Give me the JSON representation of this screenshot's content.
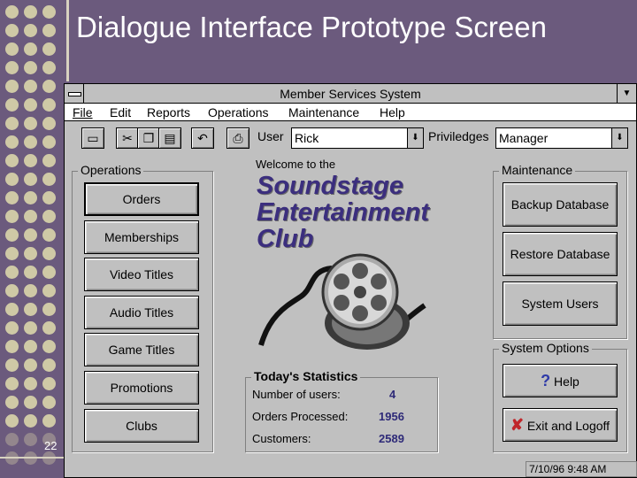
{
  "slide": {
    "title": "Dialogue Interface Prototype Screen",
    "number": "22"
  },
  "window": {
    "title": "Member Services System",
    "menu": [
      "File",
      "Edit",
      "Reports",
      "Operations",
      "Maintenance",
      "Help"
    ]
  },
  "toolbar": {
    "user_label": "User",
    "user_value": "Rick",
    "privileges_label": "Priviledges",
    "privileges_value": "Manager"
  },
  "operations": {
    "title": "Operations",
    "buttons": [
      "Orders",
      "Memberships",
      "Video Titles",
      "Audio Titles",
      "Game Titles",
      "Promotions",
      "Clubs"
    ]
  },
  "welcome": {
    "line": "Welcome to the",
    "club_line1": "Soundstage",
    "club_line2": "Entertainment",
    "club_line3": "Club"
  },
  "statistics": {
    "title": "Today's Statistics",
    "rows": [
      {
        "label": "Number of users:",
        "value": "4"
      },
      {
        "label": "Orders Processed:",
        "value": "1956"
      },
      {
        "label": "Customers:",
        "value": "2589"
      }
    ]
  },
  "maintenance": {
    "title": "Maintenance",
    "buttons": [
      "Backup Database",
      "Restore Database",
      "System Users"
    ]
  },
  "system_options": {
    "title": "System Options",
    "help_label": "Help",
    "exit_label": "Exit and Logoff"
  },
  "status": {
    "clock": "7/10/96 9:48 AM"
  },
  "colors": {
    "slide_bg": "#6b5a7d",
    "window_bg": "#c0c0c0",
    "club_text": "#3b2e7e"
  }
}
